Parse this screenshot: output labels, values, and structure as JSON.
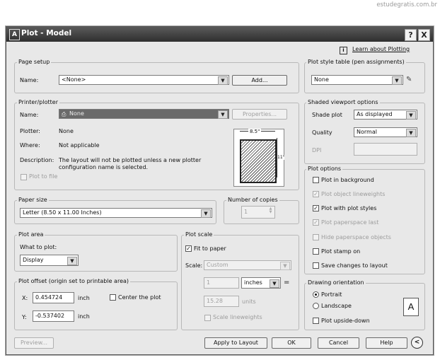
{
  "watermark": "estudegratis.com.br",
  "window": {
    "title": "Plot - Model",
    "help_btn": "?",
    "close_btn": "X",
    "app_icon": "A"
  },
  "learn_link": "Learn about Plotting",
  "page_setup": {
    "group": "Page setup",
    "name_label": "Name:",
    "name_value": "<None>",
    "add_button": "Add..."
  },
  "printer": {
    "group": "Printer/plotter",
    "name_label": "Name:",
    "name_value": "None",
    "properties_button": "Properties...",
    "plotter_label": "Plotter:",
    "plotter_value": "None",
    "where_label": "Where:",
    "where_value": "Not applicable",
    "description_label": "Description:",
    "description_line1": "The layout will not be plotted unless a new plotter",
    "description_line2": "configuration name is selected.",
    "plot_to_file": "Plot to file",
    "preview_dim_top": "8.5\"",
    "preview_dim_side": "11\""
  },
  "paper_size": {
    "group": "Paper size",
    "value": "Letter (8.50 x 11.00 Inches)"
  },
  "copies": {
    "group": "Number of copies",
    "value": "1"
  },
  "plot_area": {
    "group": "Plot area",
    "what_label": "What to plot:",
    "what_value": "Display"
  },
  "plot_offset": {
    "group": "Plot offset (origin set to printable area)",
    "x_label": "X:",
    "x_value": "0.454724",
    "x_unit": "inch",
    "y_label": "Y:",
    "y_value": "-0.537402",
    "y_unit": "inch",
    "center": "Center the plot"
  },
  "plot_scale": {
    "group": "Plot scale",
    "fit": "Fit to paper",
    "scale_label": "Scale:",
    "scale_value": "Custom",
    "num1": "1",
    "unit1": "inches",
    "equals": "=",
    "num2": "15.28",
    "unit2": "units",
    "lineweights": "Scale lineweights"
  },
  "style_table": {
    "group": "Plot style table (pen assignments)",
    "value": "None"
  },
  "shaded": {
    "group": "Shaded viewport options",
    "shade_label": "Shade plot",
    "shade_value": "As displayed",
    "quality_label": "Quality",
    "quality_value": "Normal",
    "dpi_label": "DPI"
  },
  "plot_options": {
    "group": "Plot options",
    "items": [
      {
        "label": "Plot in background",
        "checked": false,
        "enabled": true
      },
      {
        "label": "Plot object lineweights",
        "checked": true,
        "enabled": false
      },
      {
        "label": "Plot with plot styles",
        "checked": true,
        "enabled": true
      },
      {
        "label": "Plot paperspace last",
        "checked": true,
        "enabled": false
      },
      {
        "label": "Hide paperspace objects",
        "checked": false,
        "enabled": false
      },
      {
        "label": "Plot stamp on",
        "checked": false,
        "enabled": true
      },
      {
        "label": "Save changes to layout",
        "checked": false,
        "enabled": true
      }
    ]
  },
  "orientation": {
    "group": "Drawing orientation",
    "portrait": "Portrait",
    "landscape": "Landscape",
    "upside": "Plot upside-down",
    "badge": "A"
  },
  "footer": {
    "preview": "Preview...",
    "apply": "Apply to Layout",
    "ok": "OK",
    "cancel": "Cancel",
    "help": "Help",
    "expand": "<"
  }
}
